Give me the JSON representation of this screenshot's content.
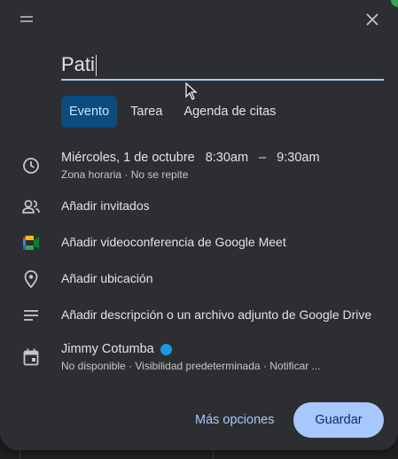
{
  "title_input": {
    "value": "Pati"
  },
  "tabs": [
    {
      "label": "Evento",
      "active": true
    },
    {
      "label": "Tarea",
      "active": false
    },
    {
      "label": "Agenda de citas",
      "active": false
    }
  ],
  "schedule": {
    "date": "Miércoles, 1 de octubre",
    "start": "8:30am",
    "separator": "–",
    "end": "9:30am",
    "details": "Zona horaria · No se repite",
    "icon": "clock-icon"
  },
  "guests": {
    "label": "Añadir invitados",
    "icon": "people-icon"
  },
  "meet": {
    "label": "Añadir videoconferencia de Google Meet",
    "icon": "google-meet-icon"
  },
  "location": {
    "label": "Añadir ubicación",
    "icon": "location-pin-icon"
  },
  "description": {
    "label": "Añadir descripción o un archivo adjunto de Google Drive",
    "icon": "notes-icon"
  },
  "calendar": {
    "name": "Jimmy Cotumba",
    "color": "#1a98e6",
    "details": "No disponible · Visibilidad predeterminada · Notificar ...",
    "icon": "calendar-icon"
  },
  "footer": {
    "more_label": "Más opciones",
    "save_label": "Guardar"
  },
  "colors": {
    "accent": "#a8c7fa",
    "active_tab": "#0a4c7d",
    "dialog_bg": "#2d2e31"
  }
}
